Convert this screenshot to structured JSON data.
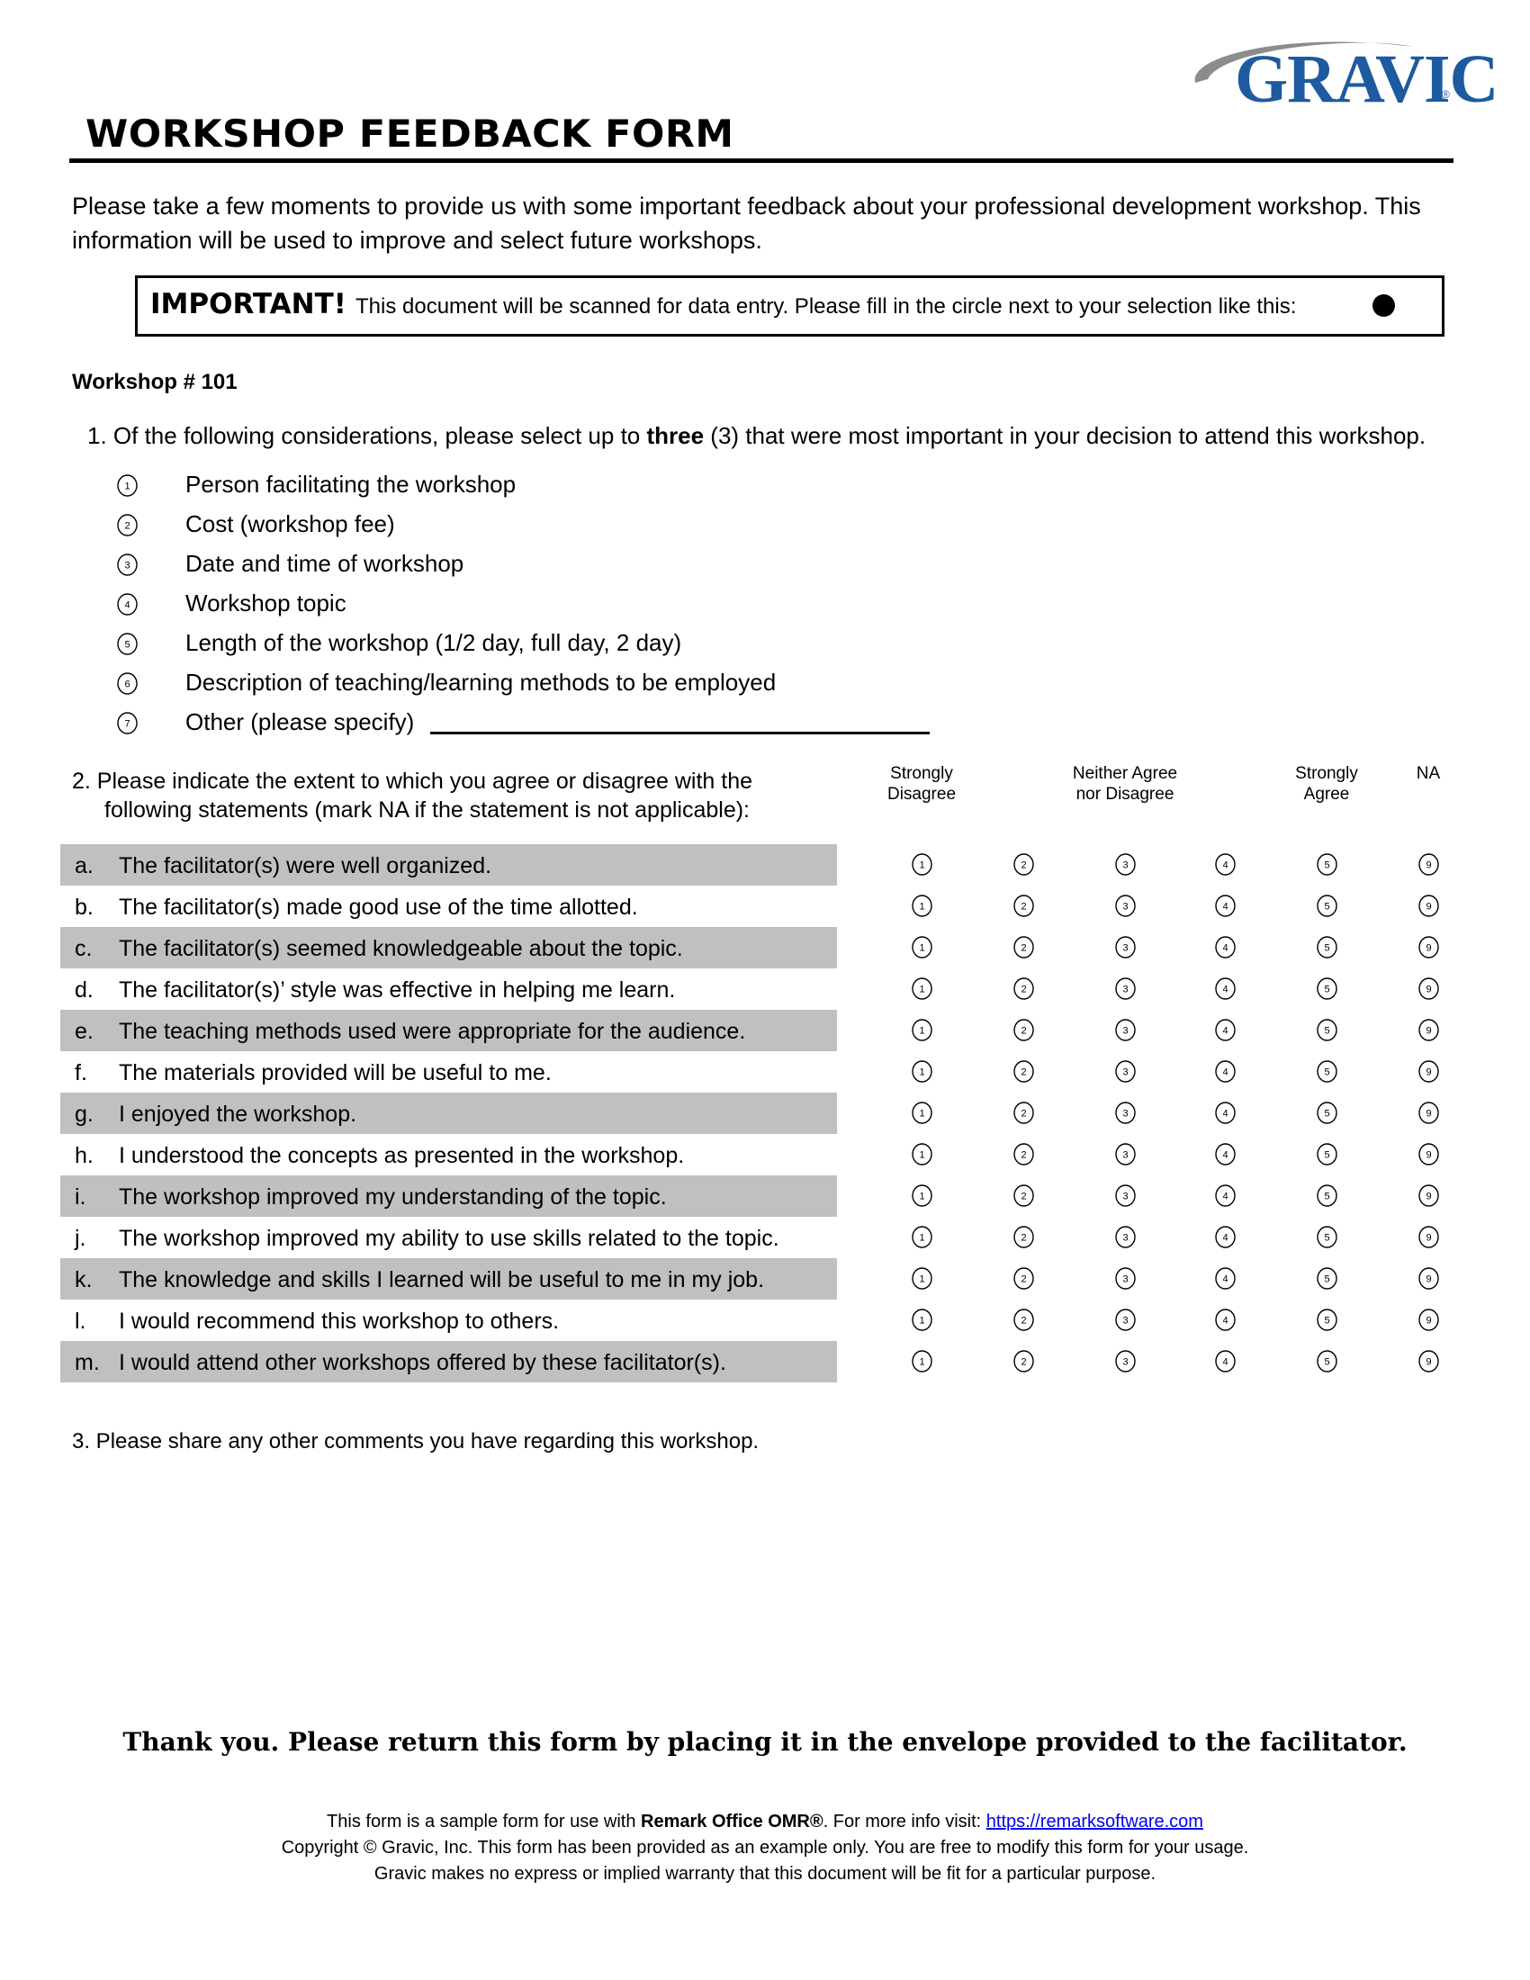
{
  "logo": {
    "brand": "GRAVIC",
    "registered": "®"
  },
  "title": "WORKSHOP FEEDBACK FORM",
  "intro": "Please take a few moments to provide us with some important feedback about your professional development workshop. This information will be used to improve and select future workshops.",
  "important": {
    "label": "IMPORTANT!",
    "text": "This document will be scanned for data entry. Please fill in the circle next to your selection like this:"
  },
  "workshop_label": "Workshop #  101",
  "q1": {
    "prefix": "1.  Of the following considerations, please select up to ",
    "emphasis": "three",
    "suffix": " (3) that were most important in your decision to attend this workshop.",
    "options": [
      {
        "num": "1",
        "label": "Person facilitating the workshop"
      },
      {
        "num": "2",
        "label": "Cost (workshop fee)"
      },
      {
        "num": "3",
        "label": "Date and time of workshop"
      },
      {
        "num": "4",
        "label": "Workshop topic"
      },
      {
        "num": "5",
        "label": "Length of the workshop (1/2 day, full day, 2 day)"
      },
      {
        "num": "6",
        "label": "Description of teaching/learning methods to be employed"
      },
      {
        "num": "7",
        "label": "Other (please specify)"
      }
    ]
  },
  "q2": {
    "line1": "2.  Please indicate the extent to which you agree or disagree with the",
    "line2": "following statements (mark NA if the statement is not applicable):",
    "scale_headers": [
      {
        "line1": "Strongly",
        "line2": "Disagree"
      },
      {
        "line1": "Neither Agree",
        "line2": "nor Disagree"
      },
      {
        "line1": "Strongly",
        "line2": "Agree"
      },
      {
        "line1": "NA",
        "line2": ""
      }
    ],
    "scale_values": [
      "1",
      "2",
      "3",
      "4",
      "5",
      "9"
    ],
    "statements": [
      {
        "letter": "a.",
        "text": "The facilitator(s) were well organized."
      },
      {
        "letter": "b.",
        "text": "The facilitator(s) made good use of the time allotted."
      },
      {
        "letter": "c.",
        "text": "The facilitator(s) seemed knowledgeable about the topic."
      },
      {
        "letter": "d.",
        "text": "The facilitator(s)’ style was effective in helping me learn."
      },
      {
        "letter": "e.",
        "text": "The teaching methods used were appropriate for the audience."
      },
      {
        "letter": "f.",
        "text": "The materials provided will be useful to me."
      },
      {
        "letter": "g.",
        "text": "I enjoyed the workshop."
      },
      {
        "letter": "h.",
        "text": "I understood the concepts as presented in the workshop."
      },
      {
        "letter": "i.",
        "text": "The workshop improved my understanding of the topic."
      },
      {
        "letter": "j.",
        "text": "The workshop improved my ability to use skills related to the topic."
      },
      {
        "letter": "k.",
        "text": "The knowledge and skills I learned will be useful to me in my job."
      },
      {
        "letter": "l.",
        "text": "I would recommend this workshop to others."
      },
      {
        "letter": "m.",
        "text": "I would attend other workshops offered by these facilitator(s)."
      }
    ]
  },
  "q3": "3.  Please share any other comments you have regarding this workshop.",
  "thanks": "Thank you. Please return this form by placing it in the envelope provided to the facilitator.",
  "footer": {
    "line1_prefix": "This form is a sample form for use with ",
    "line1_bold": "Remark Office OMR®",
    "line1_mid": ". For more info visit: ",
    "link": "https://remarksoftware.com",
    "line2": "Copyright © Gravic, Inc. This form has been provided as an example only. You are free to modify this form for your usage.",
    "line3": "Gravic makes no express or implied warranty that this document will be fit for a particular purpose."
  },
  "colors": {
    "brand_blue": "#1d5aa0",
    "logo_swoosh": "#8c8c8c",
    "row_shade": "#c0c0c0",
    "link": "#0000ee"
  }
}
